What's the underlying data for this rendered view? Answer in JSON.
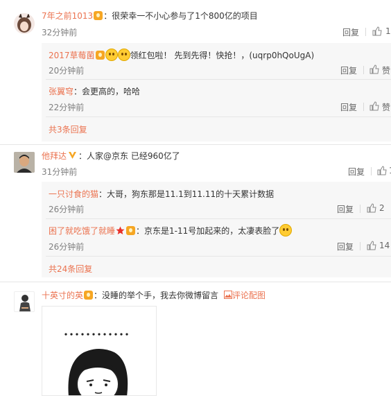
{
  "comments": [
    {
      "user": "7年之前1013",
      "text": "：很荣幸一不小心参与了1个800亿的项目",
      "time": "32分钟前",
      "reply_label": "回复",
      "like_label": "1",
      "replies": [
        {
          "user": "2017草莓菌",
          "text": "领红包啦！ 先到先得！快抢！，(uqrp0hQoUgA)",
          "time": "20分钟前",
          "reply_label": "回复",
          "like_label": "赞"
        },
        {
          "user": "张翼穹",
          "text": "：会更高的，哈哈",
          "time": "22分钟前",
          "reply_label": "回复",
          "like_label": "赞"
        }
      ],
      "more_label": "共3条回复"
    },
    {
      "user": "他拜达",
      "text": "：人家@京东 已经960亿了",
      "time": "31分钟前",
      "reply_label": "回复",
      "like_label": "1",
      "replies": [
        {
          "user": "一只讨食的猫",
          "text": "：大哥，狗东那是11.1到11.11的十天累计数据",
          "time": "26分钟前",
          "reply_label": "回复",
          "like_label": "2"
        },
        {
          "user": "困了就吃饿了就睡",
          "text": "：京东是1-11号加起来的，太凄表脸了",
          "time": "26分钟前",
          "reply_label": "回复",
          "like_label": "14"
        }
      ],
      "more_label": "共24条回复"
    },
    {
      "user": "十英寸的英",
      "text": "：没睡的举个手，我去你微博留言",
      "pic_label": "评论配图"
    }
  ]
}
